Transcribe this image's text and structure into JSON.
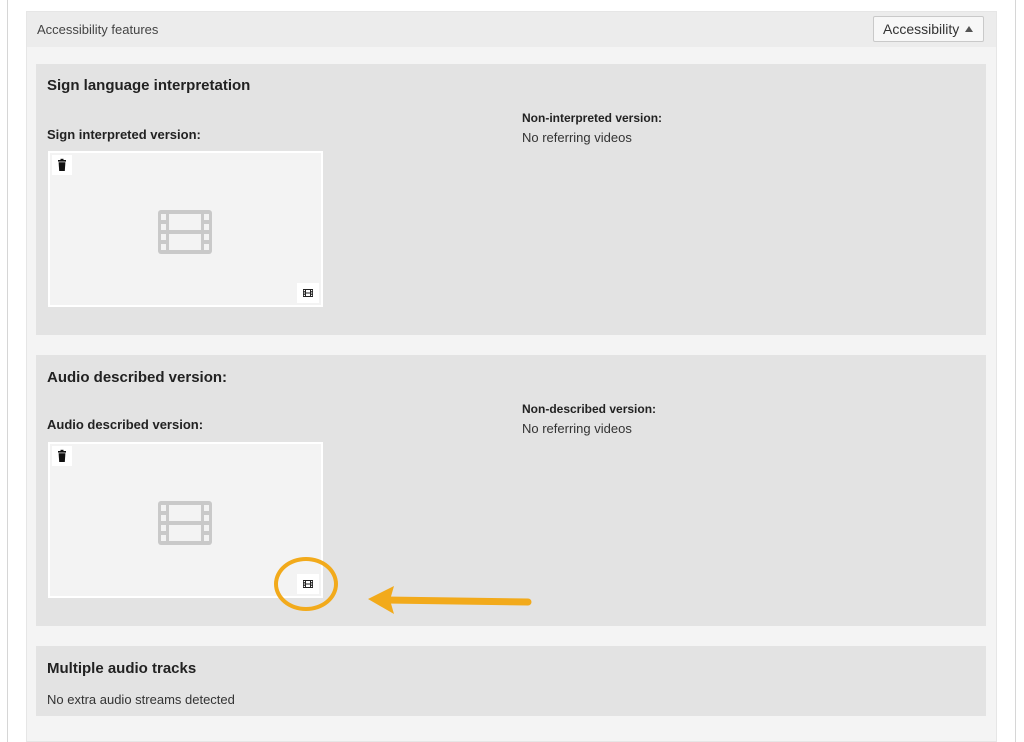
{
  "accordion": {
    "title": "Accessibility features",
    "toggle_label": "Accessibility"
  },
  "sign_language": {
    "title": "Sign language interpretation",
    "left_label": "Sign interpreted version:",
    "right_label": "Non-interpreted version:",
    "right_value": "No referring videos"
  },
  "audio_described": {
    "title": "Audio described version:",
    "left_label": "Audio described version:",
    "right_label": "Non-described version:",
    "right_value": "No referring videos"
  },
  "audio_tracks": {
    "title": "Multiple audio tracks",
    "message": "No extra audio streams detected"
  },
  "icons": {
    "delete": "trash-icon",
    "select_video": "film-icon",
    "placeholder": "film-placeholder-icon",
    "toggle": "caret-up-icon"
  },
  "colors": {
    "highlight": "#f2aa1b",
    "section_bg": "#e3e3e3",
    "placeholder_icon": "#c9c9c9"
  }
}
